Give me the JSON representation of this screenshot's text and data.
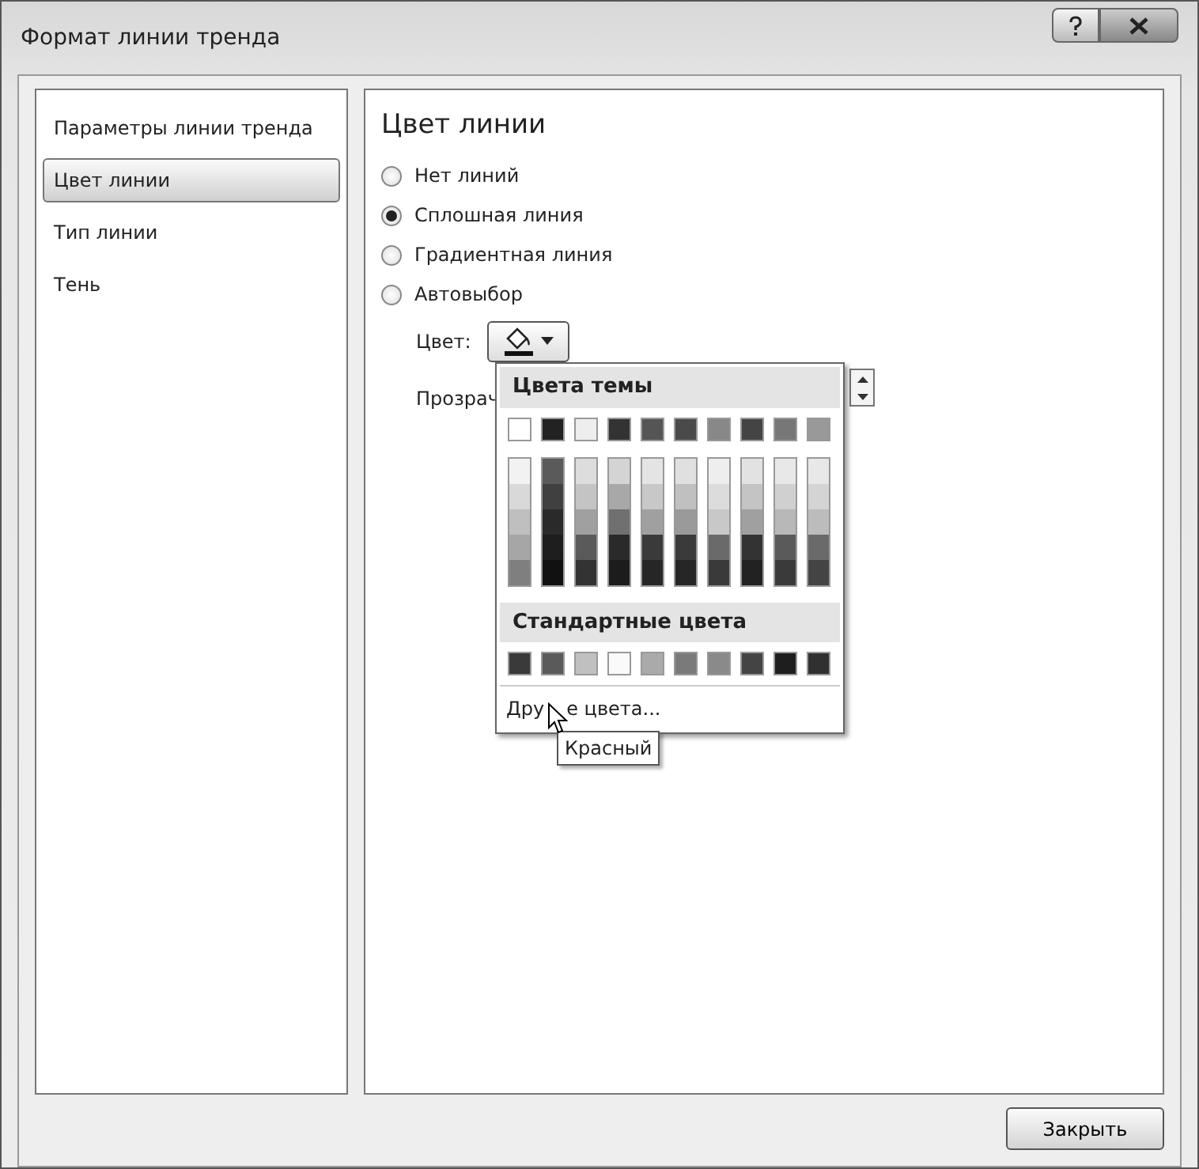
{
  "window": {
    "title": "Формат линии тренда"
  },
  "sidebar": {
    "items": [
      {
        "label": "Параметры линии тренда",
        "selected": false
      },
      {
        "label": "Цвет линии",
        "selected": true
      },
      {
        "label": "Тип линии",
        "selected": false
      },
      {
        "label": "Тень",
        "selected": false
      }
    ]
  },
  "panel": {
    "heading": "Цвет линии",
    "options": [
      {
        "label": "Нет линий",
        "selected": false
      },
      {
        "label": "Сплошная линия",
        "selected": true
      },
      {
        "label": "Градиентная линия",
        "selected": false
      },
      {
        "label": "Автовыбор",
        "selected": false
      }
    ],
    "color_label": "Цвет:",
    "transparency_label": "Прозрач"
  },
  "color_menu": {
    "theme_heading": "Цвета темы",
    "theme_colors": [
      {
        "color": "#ffffff",
        "shades": [
          {
            "color": "#f2f2f2"
          },
          {
            "color": "#d9d9d9"
          },
          {
            "color": "#bfbfbf"
          },
          {
            "color": "#a6a6a6"
          },
          {
            "color": "#7f7f7f"
          }
        ]
      },
      {
        "color": "#222222",
        "shades": [
          {
            "color": "#5a5a5a"
          },
          {
            "color": "#404040"
          },
          {
            "color": "#2a2a2a"
          },
          {
            "color": "#1e1e1e"
          },
          {
            "color": "#111111"
          }
        ]
      },
      {
        "color": "#eeeeee",
        "shades": [
          {
            "color": "#dddddd"
          },
          {
            "color": "#c4c4c4"
          },
          {
            "color": "#a0a0a0"
          },
          {
            "color": "#5a5a5a"
          },
          {
            "color": "#333333"
          }
        ]
      },
      {
        "color": "#333333",
        "shades": [
          {
            "color": "#d4d4d4"
          },
          {
            "color": "#a8a8a8"
          },
          {
            "color": "#707070"
          },
          {
            "color": "#2a2a2a"
          },
          {
            "color": "#1c1c1c"
          }
        ]
      },
      {
        "color": "#555555",
        "shades": [
          {
            "color": "#e4e4e4"
          },
          {
            "color": "#c8c8c8"
          },
          {
            "color": "#a0a0a0"
          },
          {
            "color": "#3a3a3a"
          },
          {
            "color": "#262626"
          }
        ]
      },
      {
        "color": "#4a4a4a",
        "shades": [
          {
            "color": "#e0e0e0"
          },
          {
            "color": "#c0c0c0"
          },
          {
            "color": "#9a9a9a"
          },
          {
            "color": "#3a3a3a"
          },
          {
            "color": "#262626"
          }
        ]
      },
      {
        "color": "#888888",
        "shades": [
          {
            "color": "#eeeeee"
          },
          {
            "color": "#dcdcdc"
          },
          {
            "color": "#c8c8c8"
          },
          {
            "color": "#6a6a6a"
          },
          {
            "color": "#3a3a3a"
          }
        ]
      },
      {
        "color": "#444444",
        "shades": [
          {
            "color": "#e2e2e2"
          },
          {
            "color": "#c4c4c4"
          },
          {
            "color": "#a0a0a0"
          },
          {
            "color": "#333333"
          },
          {
            "color": "#222222"
          }
        ]
      },
      {
        "color": "#777777",
        "shades": [
          {
            "color": "#e8e8e8"
          },
          {
            "color": "#d0d0d0"
          },
          {
            "color": "#b8b8b8"
          },
          {
            "color": "#5a5a5a"
          },
          {
            "color": "#3a3a3a"
          }
        ]
      },
      {
        "color": "#999999",
        "shades": [
          {
            "color": "#e8e8e8"
          },
          {
            "color": "#d4d4d4"
          },
          {
            "color": "#bcbcbc"
          },
          {
            "color": "#6a6a6a"
          },
          {
            "color": "#444444"
          }
        ]
      }
    ],
    "standard_heading": "Стандартные цвета",
    "standard_colors": [
      {
        "color": "#3a3a3a"
      },
      {
        "color": "#5a5a5a"
      },
      {
        "color": "#c0c0c0"
      },
      {
        "color": "#fafafa"
      },
      {
        "color": "#aaaaaa"
      },
      {
        "color": "#7a7a7a"
      },
      {
        "color": "#8a8a8a"
      },
      {
        "color": "#444444"
      },
      {
        "color": "#1e1e1e"
      },
      {
        "color": "#303030"
      }
    ],
    "more_colors": [
      "Дру",
      "е цвета..."
    ],
    "tooltip": "Красный"
  },
  "buttons": [
    {
      "label": "Закрыть"
    }
  ]
}
